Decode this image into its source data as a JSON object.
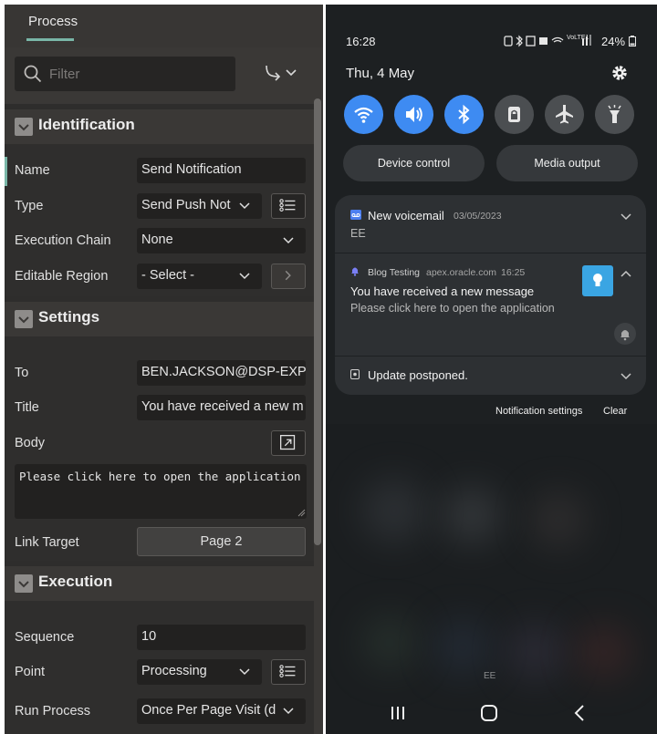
{
  "left": {
    "tab_label": "Process",
    "filter_placeholder": "Filter",
    "sections": {
      "identification": "Identification",
      "settings": "Settings",
      "execution": "Execution"
    },
    "identification": {
      "name_label": "Name",
      "name_value": "Send Notification",
      "type_label": "Type",
      "type_value": "Send Push Not",
      "execution_chain_label": "Execution Chain",
      "execution_chain_value": "None",
      "editable_region_label": "Editable Region",
      "editable_region_value": "- Select -"
    },
    "settings": {
      "to_label": "To",
      "to_value": "BEN.JACKSON@DSP-EXPL",
      "title_label": "Title",
      "title_value": "You have received a new m",
      "body_label": "Body",
      "body_value": "Please click here to open the application",
      "link_target_label": "Link Target",
      "link_target_value": "Page 2"
    },
    "execution": {
      "sequence_label": "Sequence",
      "sequence_value": "10",
      "point_label": "Point",
      "point_value": "Processing",
      "run_process_label": "Run Process",
      "run_process_value": "Once Per Page Visit (d"
    }
  },
  "phone": {
    "time": "16:28",
    "battery": "24%",
    "signal_text": "VoLTE1",
    "date": "Thu, 4 May",
    "device_control": "Device control",
    "media_output": "Media output",
    "notifications": [
      {
        "app": "New voicemail",
        "date": "03/05/2023",
        "body": "EE"
      },
      {
        "app": "Blog Testing",
        "source": "apex.oracle.com",
        "time": "16:25",
        "title": "You have received a new message",
        "body": "Please click here to open the application"
      },
      {
        "app": "Update postponed."
      }
    ],
    "notification_settings": "Notification settings",
    "clear": "Clear",
    "carrier_bottom": "EE",
    "colors": {
      "accent_blue": "#3e8bf2",
      "teal_accent": "#79b6a7",
      "app_icon_blue": "#3aa5e3"
    }
  }
}
